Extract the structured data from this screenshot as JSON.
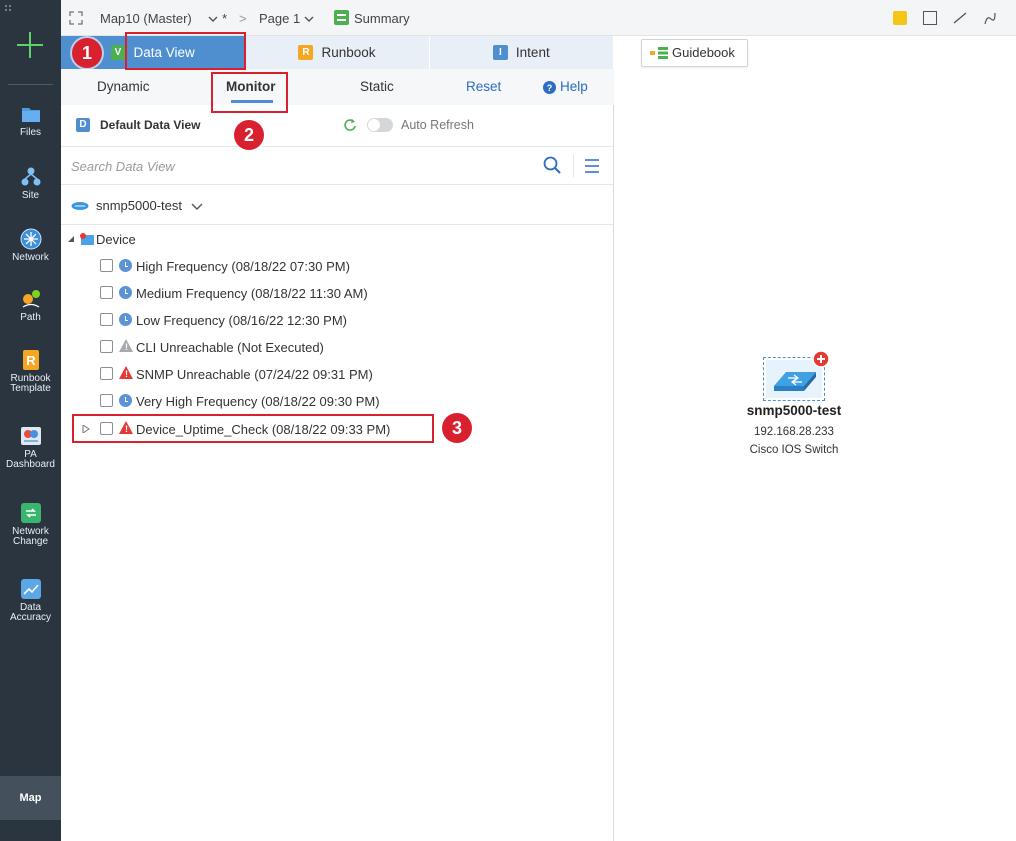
{
  "rail": {
    "files": "Files",
    "site": "Site",
    "network": "Network",
    "path": "Path",
    "runbook_line1": "Runbook",
    "runbook_line2": "Template",
    "pa_line1": "PA",
    "pa_line2": "Dashboard",
    "netchange_line1": "Network",
    "netchange_line2": "Change",
    "data_line1": "Data",
    "data_line2": "Accuracy",
    "map": "Map"
  },
  "topbar": {
    "map_title": "Map10 (Master)",
    "unsaved": "*",
    "separator": ">",
    "page": "Page 1",
    "summary": "Summary"
  },
  "tabs": {
    "data_view": "Data View",
    "runbook": "Runbook",
    "intent": "Intent"
  },
  "subtabs": {
    "dynamic": "Dynamic",
    "monitor": "Monitor",
    "static": "Static",
    "reset": "Reset",
    "help": "Help"
  },
  "dataview": {
    "badge": "D",
    "name": "Default Data View",
    "auto_refresh": "Auto Refresh"
  },
  "search": {
    "placeholder": "Search Data View"
  },
  "device_select": "snmp5000-test",
  "tree": {
    "root": "Device",
    "items": [
      {
        "label": "High Frequency (08/18/22 07:30 PM)",
        "icon": "clock-icon"
      },
      {
        "label": "Medium Frequency (08/18/22 11:30 AM)",
        "icon": "clock-icon"
      },
      {
        "label": "Low Frequency (08/16/22 12:30 PM)",
        "icon": "clock-icon"
      },
      {
        "label": "CLI Unreachable (Not Executed)",
        "icon": "warning-gray-icon"
      },
      {
        "label": "SNMP Unreachable (07/24/22 09:31 PM)",
        "icon": "warning-red-icon"
      },
      {
        "label": "Very High Frequency (08/18/22 09:30 PM)",
        "icon": "clock-icon"
      },
      {
        "label": "Device_Uptime_Check (08/18/22 09:33 PM)",
        "icon": "warning-red-icon"
      }
    ]
  },
  "callouts": [
    "1",
    "2",
    "3"
  ],
  "canvas": {
    "guidebook": "Guidebook",
    "device_name": "snmp5000-test",
    "device_ip": "192.168.28.233",
    "device_type": "Cisco IOS Switch"
  },
  "colors": {
    "accent": "#4f8fd0",
    "highlight": "#d8202f",
    "rail": "#2a3540"
  }
}
